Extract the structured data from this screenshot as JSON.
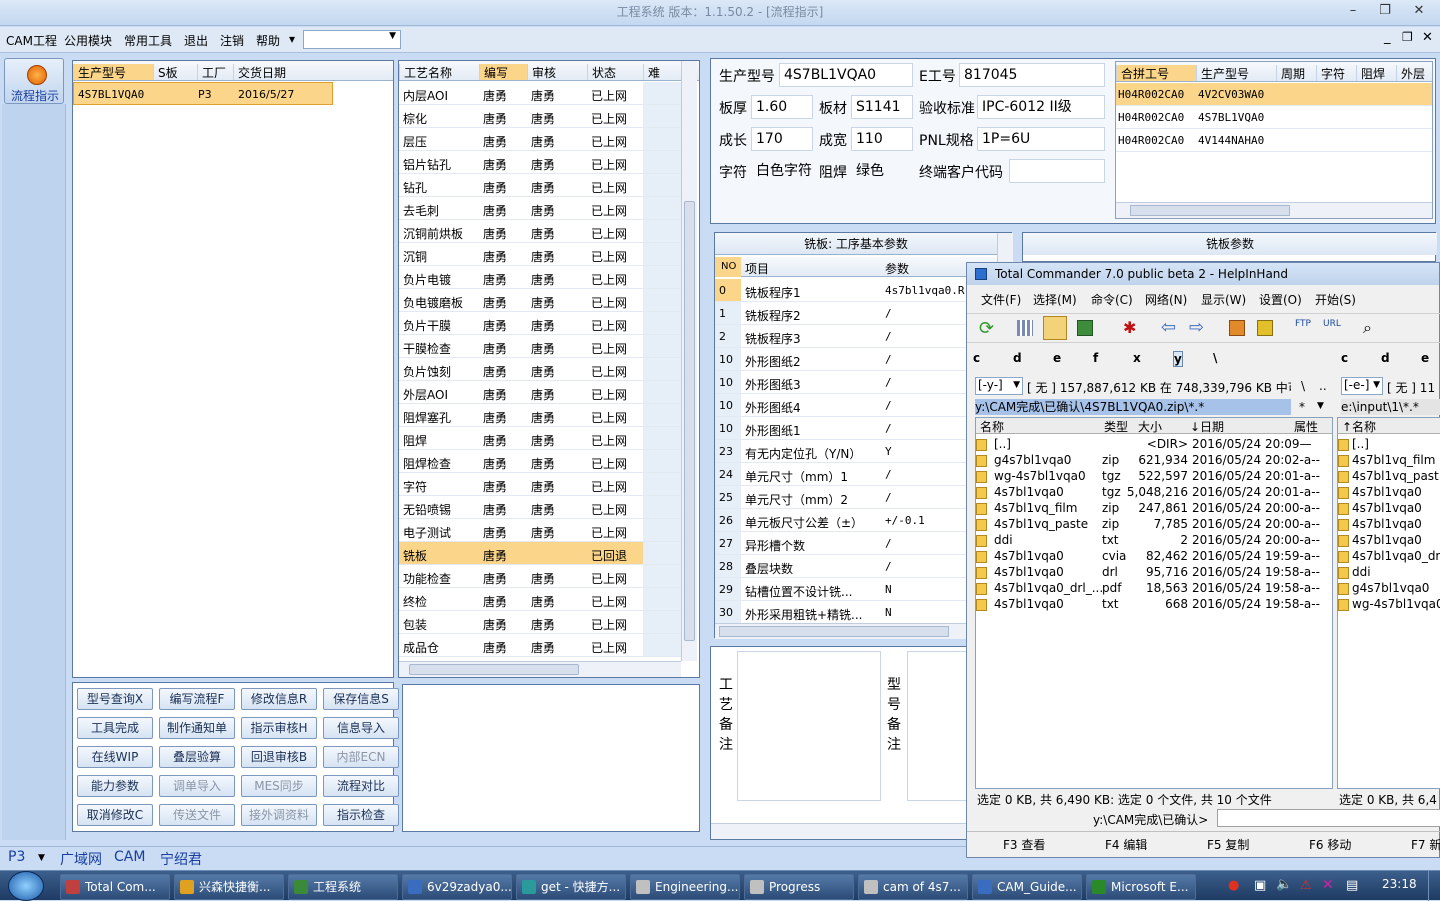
{
  "window": {
    "title": "工程系统  版本：1.1.50.2 - [流程指示]",
    "min": "–",
    "max": "❐",
    "close": "✕"
  },
  "menu": [
    "CAM工程",
    "公用模块",
    "常用工具",
    "退出",
    "注销",
    "帮助"
  ],
  "menu_help_arrow": "▾",
  "sidebar": {
    "flow_button": "流程指示"
  },
  "orders": {
    "headers": [
      "生产型号",
      "S板",
      "工厂",
      "交货日期"
    ],
    "rows": [
      [
        "4S7BL1VQA0",
        "",
        "P3",
        "2016/5/27"
      ]
    ]
  },
  "process": {
    "headers": [
      "工艺名称",
      "编写",
      "审核",
      "状态",
      "难"
    ],
    "rows": [
      [
        "内层AOI",
        "唐勇",
        "唐勇",
        "已上网"
      ],
      [
        "棕化",
        "唐勇",
        "唐勇",
        "已上网"
      ],
      [
        "层压",
        "唐勇",
        "唐勇",
        "已上网"
      ],
      [
        "铝片钻孔",
        "唐勇",
        "唐勇",
        "已上网"
      ],
      [
        "钻孔",
        "唐勇",
        "唐勇",
        "已上网"
      ],
      [
        "去毛刺",
        "唐勇",
        "唐勇",
        "已上网"
      ],
      [
        "沉铜前烘板",
        "唐勇",
        "唐勇",
        "已上网"
      ],
      [
        "沉铜",
        "唐勇",
        "唐勇",
        "已上网"
      ],
      [
        "负片电镀",
        "唐勇",
        "唐勇",
        "已上网"
      ],
      [
        "负电镀磨板",
        "唐勇",
        "唐勇",
        "已上网"
      ],
      [
        "负片干膜",
        "唐勇",
        "唐勇",
        "已上网"
      ],
      [
        "干膜检查",
        "唐勇",
        "唐勇",
        "已上网"
      ],
      [
        "负片蚀刻",
        "唐勇",
        "唐勇",
        "已上网"
      ],
      [
        "外层AOI",
        "唐勇",
        "唐勇",
        "已上网"
      ],
      [
        "阻焊塞孔",
        "唐勇",
        "唐勇",
        "已上网"
      ],
      [
        "阻焊",
        "唐勇",
        "唐勇",
        "已上网"
      ],
      [
        "阻焊检查",
        "唐勇",
        "唐勇",
        "已上网"
      ],
      [
        "字符",
        "唐勇",
        "唐勇",
        "已上网"
      ],
      [
        "无铅喷锡",
        "唐勇",
        "唐勇",
        "已上网"
      ],
      [
        "电子测试",
        "唐勇",
        "唐勇",
        "已上网"
      ],
      [
        "铣板",
        "唐勇",
        "",
        "已回退"
      ],
      [
        "功能检查",
        "唐勇",
        "唐勇",
        "已上网"
      ],
      [
        "终检",
        "唐勇",
        "唐勇",
        "已上网"
      ],
      [
        "包装",
        "唐勇",
        "唐勇",
        "已上网"
      ],
      [
        "成品仓",
        "唐勇",
        "唐勇",
        "已上网"
      ]
    ]
  },
  "buttons": [
    [
      "型号查询X",
      "编写流程F",
      "修改信息R",
      "保存信息S"
    ],
    [
      "工具完成",
      "制作通知单",
      "指示审核H",
      "信息导入"
    ],
    [
      "在线WIP",
      "叠层验算",
      "回退审核B",
      "内部ECN"
    ],
    [
      "能力参数",
      "调单导入",
      "MES同步",
      "流程对比"
    ],
    [
      "取消修改C",
      "传送文件",
      "接外调资料",
      "指示检查"
    ]
  ],
  "disabled_buttons": [
    "内部ECN",
    "调单导入",
    "MES同步",
    "传送文件",
    "接外调资料"
  ],
  "info": {
    "型号label": "生产型号",
    "型号": "4S7BL1VQA0",
    "E工号label": "E工号",
    "E工号": "817045",
    "板厚label": "板厚",
    "板厚": "1.60",
    "板材label": "板材",
    "板材": "S1141",
    "验收标准label": "验收标准",
    "验收标准": "IPC-6012 II级",
    "成长label": "成长",
    "成长": "170",
    "成宽label": "成宽",
    "成宽": "110",
    "PNL规格label": "PNL规格",
    "PNL规格": "1P=6U",
    "字符label": "字符",
    "字符": "白色字符",
    "阻焊label": "阻焊",
    "阻焊": "绿色",
    "终端label": "终端客户代码",
    "终端": ""
  },
  "combo": {
    "headers": [
      "合拼工号",
      "生产型号",
      "周期",
      "字符",
      "阻焊",
      "外层"
    ],
    "rows": [
      [
        "H04R002CA0",
        "4V2CV03WA0"
      ],
      [
        "H04R002CA0",
        "4S7BL1VQA0"
      ],
      [
        "H04R002CA0",
        "4V144NAHA0"
      ]
    ]
  },
  "params": {
    "title": "铣板: 工序基本参数",
    "headers": [
      "NO",
      "项目",
      "参数"
    ],
    "rows": [
      [
        "0",
        "铣板程序1",
        "4s7bl1vqa0.R"
      ],
      [
        "1",
        "铣板程序2",
        "/"
      ],
      [
        "2",
        "铣板程序3",
        "/"
      ],
      [
        "10",
        "外形图纸2",
        "/"
      ],
      [
        "10",
        "外形图纸3",
        "/"
      ],
      [
        "10",
        "外形图纸4",
        "/"
      ],
      [
        "10",
        "外形图纸1",
        "/"
      ],
      [
        "23",
        "有无内定位孔（Y/N）",
        "Y"
      ],
      [
        "24",
        "单元尺寸（mm）1",
        "/"
      ],
      [
        "25",
        "单元尺寸（mm）2",
        "/"
      ],
      [
        "26",
        "单元板尺寸公差（±）",
        "+/-0.1"
      ],
      [
        "27",
        "异形槽个数",
        "/"
      ],
      [
        "28",
        "叠层块数",
        "/"
      ],
      [
        "29",
        "钻槽位置不设计铣...",
        "N"
      ],
      [
        "30",
        "外形采用粗铣+精铣...",
        "N"
      ]
    ]
  },
  "params2": {
    "title": "铣板参数"
  },
  "notes": {
    "process_label": "工艺备注",
    "model_label": "型号备注"
  },
  "status": {
    "factory": "P3",
    "tabs": [
      "广域网",
      "CAM",
      "宁绍君"
    ]
  },
  "tc": {
    "title": "Total Commander 7.0 public beta 2 - HelpInHand",
    "menu": [
      "文件(F)",
      "选择(M)",
      "命令(C)",
      "网络(N)",
      "显示(W)",
      "设置(O)",
      "开始(S)"
    ],
    "drives": [
      "c",
      "d",
      "e",
      "f",
      "x",
      "y",
      "\\"
    ],
    "drives_right": [
      "c",
      "d",
      "e"
    ],
    "drive_sel": "[-y-]",
    "drive_info": "[ 无 ]  157,887,612 KB 在 748,339,796 KB 中可",
    "drive_sel_r": "[-e-]",
    "drive_info_r": "[ 无 ]  11",
    "path": "y:\\CAM完成\\已确认\\4S7BL1VQA0.zip\\*.*",
    "path_r": "e:\\input\\1\\*.*",
    "headers": [
      "名称",
      "类型",
      "大小",
      "↓日期",
      "属性"
    ],
    "header_r": "↑名称",
    "files": [
      [
        "[..]",
        "",
        "<DIR>",
        "2016/05/24 20:09—"
      ],
      [
        "g4s7bl1vqa0",
        "zip",
        "621,934",
        "2016/05/24 20:02-a--"
      ],
      [
        "wg-4s7bl1vqa0",
        "tgz",
        "522,597",
        "2016/05/24 20:01-a--"
      ],
      [
        "4s7bl1vqa0",
        "tgz",
        "5,048,216",
        "2016/05/24 20:01-a--"
      ],
      [
        "4s7bl1vq_film",
        "zip",
        "247,861",
        "2016/05/24 20:00-a--"
      ],
      [
        "4s7bl1vq_paste",
        "zip",
        "7,785",
        "2016/05/24 20:00-a--"
      ],
      [
        "ddi",
        "txt",
        "2",
        "2016/05/24 20:00-a--"
      ],
      [
        "4s7bl1vqa0",
        "cvia",
        "82,462",
        "2016/05/24 19:59-a--"
      ],
      [
        "4s7bl1vqa0",
        "drl",
        "95,716",
        "2016/05/24 19:58-a--"
      ],
      [
        "4s7bl1vqa0_drl_...",
        "pdf",
        "18,563",
        "2016/05/24 19:58-a--"
      ],
      [
        "4s7bl1vqa0",
        "txt",
        "668",
        "2016/05/24 19:58-a--"
      ]
    ],
    "files_r": [
      "[..]",
      "4s7bl1vq_film",
      "4s7bl1vq_past",
      "4s7bl1vqa0",
      "4s7bl1vqa0",
      "4s7bl1vqa0",
      "4s7bl1vqa0",
      "4s7bl1vqa0_dr",
      "ddi",
      "g4s7bl1vqa0",
      "wg-4s7bl1vqa0"
    ],
    "status_l": "选定 0 KB, 共 6,490 KB: 选定 0 个文件, 共 10 个文件",
    "status_r": "选定 0 KB, 共 6,4",
    "cmd": "y:\\CAM完成\\已确认>",
    "fkeys": [
      "F3 查看",
      "F4 编辑",
      "F5 复制",
      "F6 移动",
      "F7 新"
    ]
  },
  "taskbar": {
    "items": [
      "Total Com...",
      "兴森快捷衡...",
      "工程系统",
      "6v29zadya0...",
      "get - 快捷方...",
      "Engineering...",
      "Progress",
      "cam of 4s7...",
      "CAM_Guide...",
      "Microsoft E..."
    ],
    "time": "23:18"
  }
}
